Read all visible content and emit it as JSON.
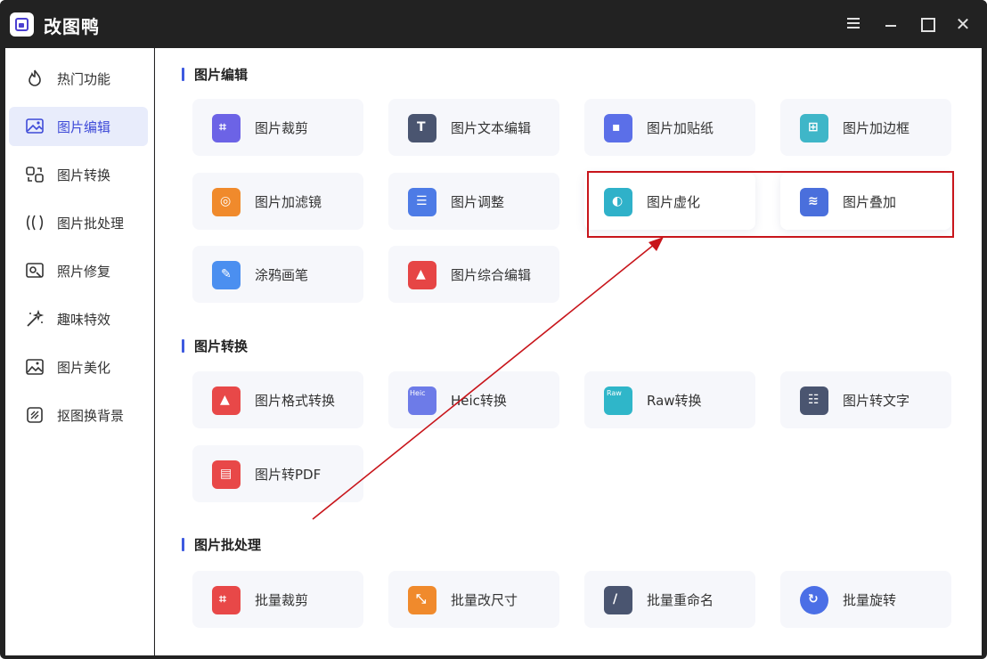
{
  "app": {
    "title": "改图鸭"
  },
  "window": {
    "menu_icon": "menu-icon",
    "min_icon": "minimize-icon",
    "max_icon": "maximize-icon",
    "close_icon": "close-icon",
    "close_glyph": "✕"
  },
  "sidebar": {
    "items": [
      {
        "label": "热门功能",
        "icon": "flame-icon"
      },
      {
        "label": "图片编辑",
        "icon": "image-edit-icon"
      },
      {
        "label": "图片转换",
        "icon": "convert-icon"
      },
      {
        "label": "图片批处理",
        "icon": "batch-icon"
      },
      {
        "label": "照片修复",
        "icon": "photo-repair-icon"
      },
      {
        "label": "趣味特效",
        "icon": "magic-wand-icon"
      },
      {
        "label": "图片美化",
        "icon": "beautify-icon"
      },
      {
        "label": "抠图换背景",
        "icon": "cutout-icon"
      }
    ],
    "active_index": 1
  },
  "sections": {
    "edit": {
      "title": "图片编辑",
      "items": [
        {
          "label": "图片裁剪",
          "icon": "crop-icon",
          "color": "#6c63e6"
        },
        {
          "label": "图片文本编辑",
          "icon": "text-edit-icon",
          "color": "#4a5570"
        },
        {
          "label": "图片加贴纸",
          "icon": "sticker-icon",
          "color": "#5b6fe8"
        },
        {
          "label": "图片加边框",
          "icon": "frame-icon",
          "color": "#3fb6c8"
        },
        {
          "label": "图片加滤镜",
          "icon": "filter-icon",
          "color": "#f08a2c"
        },
        {
          "label": "图片调整",
          "icon": "adjust-icon",
          "color": "#4d7be6"
        },
        {
          "label": "图片虚化",
          "icon": "blur-icon",
          "color": "#2fb1c9"
        },
        {
          "label": "图片叠加",
          "icon": "overlay-icon",
          "color": "#4a6fdc"
        },
        {
          "label": "涂鸦画笔",
          "icon": "brush-icon",
          "color": "#4b8ff0"
        },
        {
          "label": "图片综合编辑",
          "icon": "composite-edit-icon",
          "color": "#e64545"
        }
      ]
    },
    "convert": {
      "title": "图片转换",
      "items": [
        {
          "label": "图片格式转换",
          "icon": "format-convert-icon",
          "color": "#e84848"
        },
        {
          "label": "Heic转换",
          "icon": "heic-icon",
          "color": "#6d7be8",
          "badge": "Heic"
        },
        {
          "label": "Raw转换",
          "icon": "raw-icon",
          "color": "#2fb6c9",
          "badge": "Raw"
        },
        {
          "label": "图片转文字",
          "icon": "image-to-text-icon",
          "color": "#4a5570"
        },
        {
          "label": "图片转PDF",
          "icon": "pdf-icon",
          "color": "#e84848"
        }
      ]
    },
    "batch": {
      "title": "图片批处理",
      "items": [
        {
          "label": "批量裁剪",
          "icon": "batch-crop-icon",
          "color": "#e84848"
        },
        {
          "label": "批量改尺寸",
          "icon": "batch-resize-icon",
          "color": "#f08a2c"
        },
        {
          "label": "批量重命名",
          "icon": "batch-rename-icon",
          "color": "#4a5570"
        },
        {
          "label": "批量旋转",
          "icon": "batch-rotate-icon",
          "color": "#4b6fe6"
        }
      ]
    }
  },
  "annotation": {
    "color": "#c8151b"
  }
}
